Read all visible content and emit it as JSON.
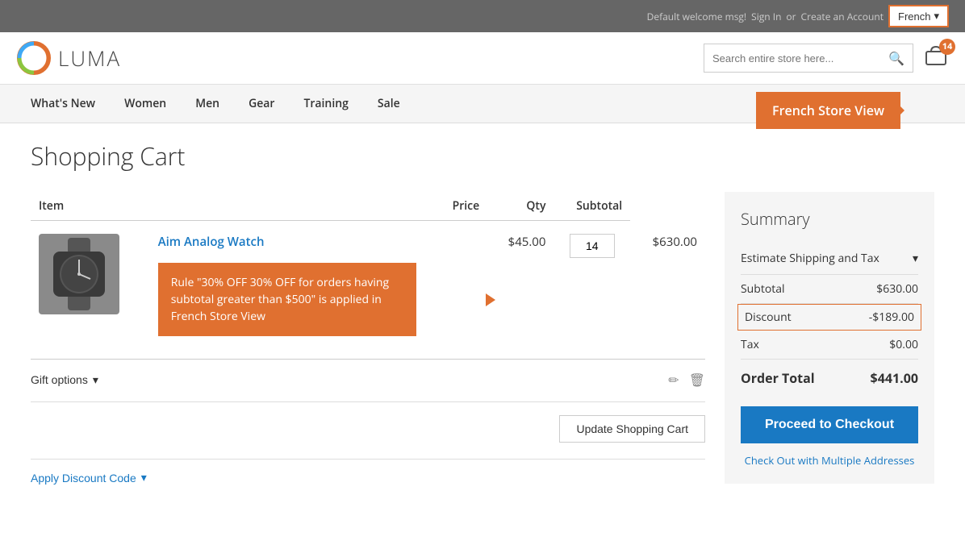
{
  "topbar": {
    "welcome": "Default welcome msg!",
    "signin": "Sign In",
    "or": "or",
    "create_account": "Create an Account",
    "language_btn": "French",
    "language_chevron": "▾"
  },
  "header": {
    "logo_text": "LUMA",
    "search_placeholder": "Search entire store here...",
    "cart_count": "14"
  },
  "french_store_tooltip": "French Store View",
  "nav": {
    "items": [
      {
        "label": "What's New"
      },
      {
        "label": "Women"
      },
      {
        "label": "Men"
      },
      {
        "label": "Gear"
      },
      {
        "label": "Training"
      },
      {
        "label": "Sale"
      }
    ]
  },
  "page": {
    "title": "Shopping Cart"
  },
  "cart_table": {
    "columns": [
      "Item",
      "Price",
      "Qty",
      "Subtotal"
    ],
    "product": {
      "name": "Aim Analog Watch",
      "price": "$45.00",
      "qty": "14",
      "subtotal": "$630.00"
    }
  },
  "rule_callout": "Rule \"30% OFF 30% OFF for orders having subtotal greater than $500\" is applied in French Store View",
  "gift_options": {
    "label": "Gift options",
    "chevron": "▾"
  },
  "update_cart_btn": "Update Shopping Cart",
  "discount_code": {
    "label": "Apply Discount Code",
    "chevron": "▾"
  },
  "summary": {
    "title": "Summary",
    "estimate_shipping": "Estimate Shipping and Tax",
    "subtotal_label": "Subtotal",
    "subtotal_value": "$630.00",
    "discount_label": "Discount",
    "discount_value": "-$189.00",
    "tax_label": "Tax",
    "tax_value": "$0.00",
    "order_total_label": "Order Total",
    "order_total_value": "$441.00",
    "checkout_btn": "Proceed to Checkout",
    "multi_address": "Check Out with Multiple Addresses"
  },
  "icons": {
    "search": "🔍",
    "cart": "🛒",
    "chevron_down": "▾",
    "edit": "✏",
    "delete": "🗑"
  }
}
